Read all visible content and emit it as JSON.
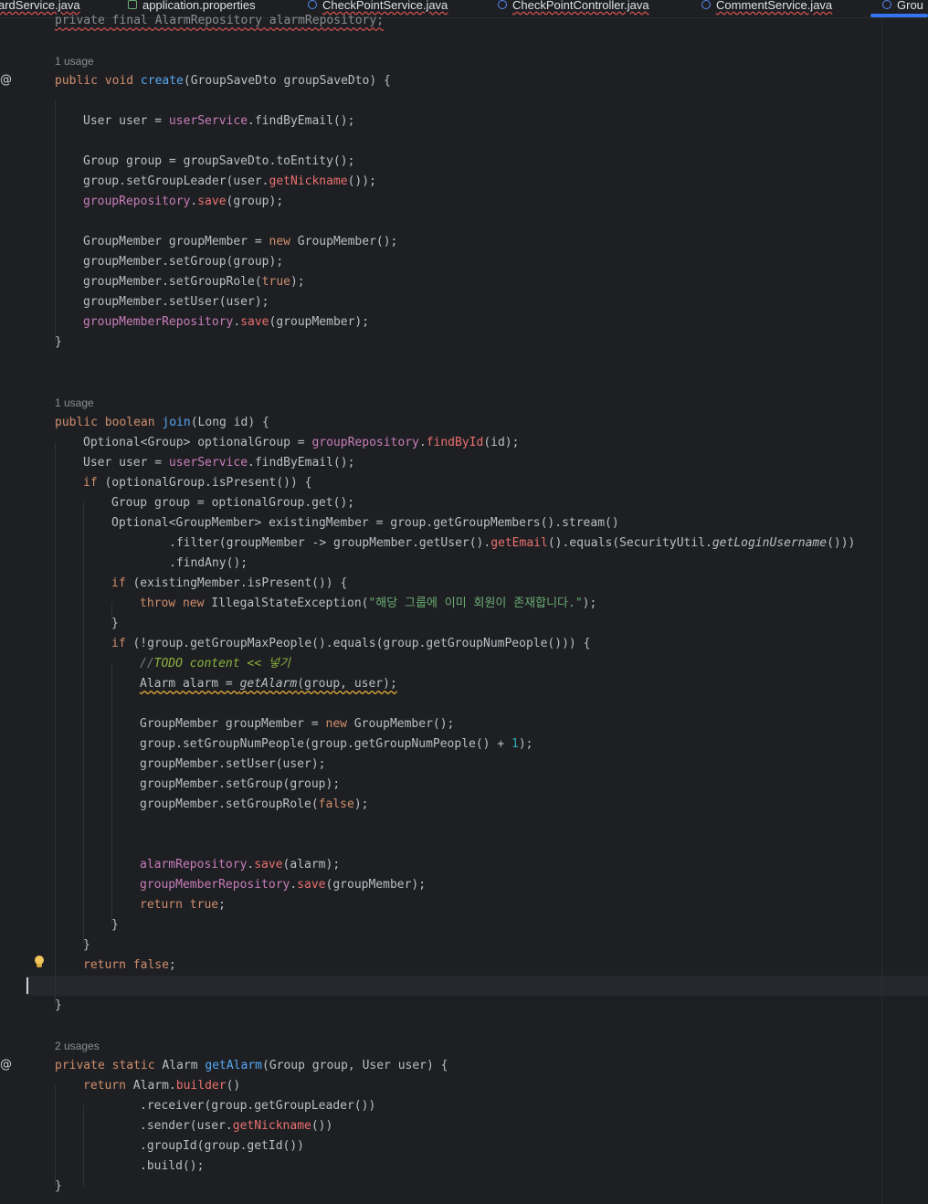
{
  "tabs": [
    {
      "label": "ardService.java",
      "icon": "java-class-icon",
      "active": false
    },
    {
      "label": "application.properties",
      "icon": "properties-file-icon",
      "active": false
    },
    {
      "label": "CheckPointService.java",
      "icon": "java-class-icon",
      "active": false
    },
    {
      "label": "CheckPointController.java",
      "icon": "java-class-icon",
      "active": false
    },
    {
      "label": "CommentService.java",
      "icon": "java-class-icon",
      "active": false
    },
    {
      "label": "Grou",
      "icon": "java-class-icon",
      "active": true
    }
  ],
  "usage_hints": {
    "create": "1 usage",
    "join": "1 usage",
    "get_alarm": "2 usages"
  },
  "gutter": {
    "create_marker": "@",
    "get_alarm_marker": "@",
    "intention_icon": "lightbulb-icon"
  },
  "code": {
    "top_field": "private final AlarmRepository alarmRepository;",
    "create_sig": {
      "p1": "public void ",
      "name": "create",
      "p2": "(GroupSaveDto groupSaveDto) {"
    },
    "c1": {
      "a": "User user = ",
      "b": "userService",
      "c": ".findByEmail();"
    },
    "c2": "Group group = groupSaveDto.toEntity();",
    "c3": {
      "a": "group.setGroupLeader(user.",
      "b": "getNickname",
      "c": "());"
    },
    "c4": {
      "a": "groupRepository",
      "b": ".",
      "c": "save",
      "d": "(group);"
    },
    "c5": {
      "a": "GroupMember groupMember = ",
      "b": "new",
      "c": " GroupMember();"
    },
    "c6": "groupMember.setGroup(group);",
    "c7": {
      "a": "groupMember.setGroupRole(",
      "b": "true",
      "c": ");"
    },
    "c8": "groupMember.setUser(user);",
    "c9": {
      "a": "groupMemberRepository",
      "b": ".",
      "c": "save",
      "d": "(groupMember);"
    },
    "close_brace": "}",
    "join_sig": {
      "p1": "public boolean ",
      "name": "join",
      "p2": "(Long id) {"
    },
    "j1": {
      "a": "Optional<Group> optionalGroup = ",
      "b": "groupRepository",
      "c": ".",
      "d": "findById",
      "e": "(id);"
    },
    "j2": {
      "a": "User user = ",
      "b": "userService",
      "c": ".findByEmail();"
    },
    "j3": {
      "a": "if",
      "b": " (optionalGroup.isPresent()) {"
    },
    "j4": "Group group = optionalGroup.get();",
    "j5": "Optional<GroupMember> existingMember = group.getGroupMembers().stream()",
    "j6": {
      "a": ".filter(groupMember -> groupMember.getUser().",
      "b": "getEmail",
      "c": "().equals(SecurityUtil.",
      "d": "getLoginUsername",
      "e": "()))"
    },
    "j7": ".findAny();",
    "j8": {
      "a": "if",
      "b": " (existingMember.isPresent()) {"
    },
    "j9": {
      "a": "throw new",
      "b": " IllegalStateException(",
      "c": "\"해당 그룹에 이미 회원이 존재합니다.\"",
      "d": ");"
    },
    "j11": {
      "a": "if",
      "b": " (!group.getGroupMaxPeople().equals(group.getGroupNumPeople())) {"
    },
    "j12": {
      "a": "//",
      "b": "TODO content << 넣기"
    },
    "j13": {
      "a": "Alarm alarm = ",
      "b": "getAlarm",
      "c": "(group, user);"
    },
    "j14": {
      "a": "GroupMember groupMember = ",
      "b": "new",
      "c": " GroupMember();"
    },
    "j15": {
      "a": "group.setGroupNumPeople(group.getGroupNumPeople() + ",
      "b": "1",
      "c": ");"
    },
    "j16": "groupMember.setUser(user);",
    "j17": "groupMember.setGroup(group);",
    "j18": {
      "a": "groupMember.setGroupRole(",
      "b": "false",
      "c": ");"
    },
    "j19": {
      "a": "alarmRepository",
      "b": ".",
      "c": "save",
      "d": "(alarm);"
    },
    "j20": {
      "a": "groupMemberRepository",
      "b": ".",
      "c": "save",
      "d": "(groupMember);"
    },
    "j21": {
      "a": "return true",
      "b": ";"
    },
    "j24": {
      "a": "return false",
      "b": ";"
    },
    "alarm_sig": {
      "p1": "private static ",
      "p2": "Alarm ",
      "name": "getAlarm",
      "p3": "(Group group, User user) {"
    },
    "a1": {
      "a": "return",
      "b": " Alarm.",
      "c": "builder",
      "d": "()"
    },
    "a2": ".receiver(group.getGroupLeader())",
    "a3": {
      "a": ".sender(user.",
      "b": "getNickname",
      "c": "())"
    },
    "a4": ".groupId(group.getId())",
    "a5": ".build();"
  }
}
